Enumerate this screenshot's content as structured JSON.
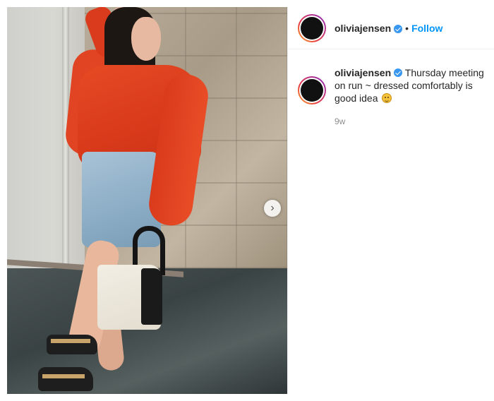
{
  "post": {
    "header": {
      "username": "oliviajensen",
      "separator": "•",
      "follow_label": "Follow"
    },
    "caption": {
      "username": "oliviajensen",
      "text": " Thursday meeting on run ~ dressed comfortably is good idea",
      "emoji": "slightly-smiling-face"
    },
    "timestamp": "9w",
    "media": {
      "next_button_glyph": "›"
    }
  },
  "colors": {
    "accent": "#0095f6",
    "verified": "#3897f0",
    "timestamp": "#8e8e8e"
  }
}
